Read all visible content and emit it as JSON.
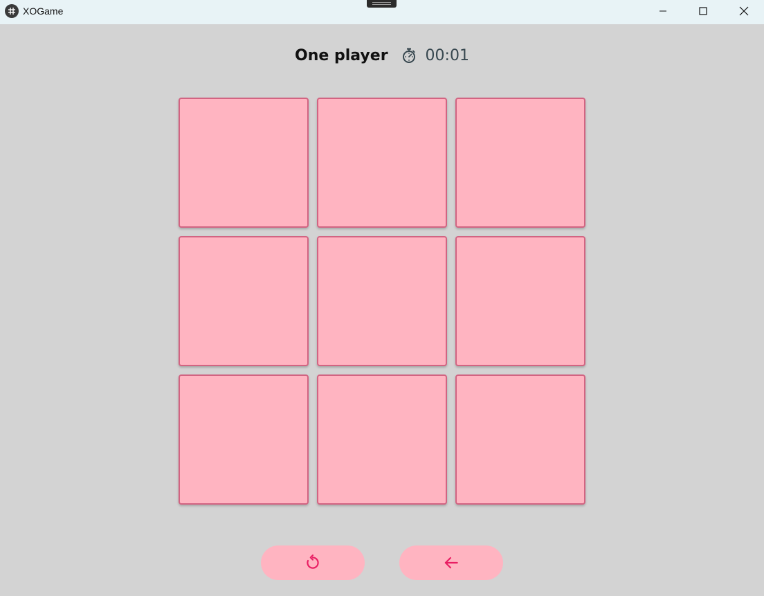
{
  "window": {
    "title": "XOGame",
    "icon": "app-logo-icon",
    "controls": [
      "minimize-icon",
      "maximize-icon",
      "close-icon"
    ]
  },
  "header": {
    "mode": "One player",
    "timer_icon": "stopwatch-icon",
    "timer": "00:01"
  },
  "board": {
    "rows": 3,
    "cols": 3,
    "cells": [
      "",
      "",
      "",
      "",
      "",
      "",
      "",
      "",
      ""
    ]
  },
  "actions": {
    "restart_icon": "restart-icon",
    "back_icon": "arrow-left-icon"
  },
  "colors": {
    "background": "#d3d3d3",
    "titlebar": "#e8f3f6",
    "cell_fill": "#ffb4c1",
    "cell_border": "#d26482",
    "accent": "#e91e63",
    "timer_text": "#37474f"
  }
}
